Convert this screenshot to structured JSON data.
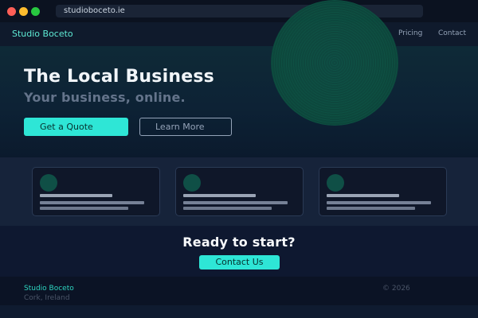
{
  "browser": {
    "url": "studioboceto.ie"
  },
  "nav": {
    "brand": "Studio Boceto",
    "links": [
      "",
      "",
      "",
      "Pricing",
      "Contact"
    ]
  },
  "hero": {
    "title": "The Local Business",
    "subtitle": "Your business, online.",
    "primary_button": "Get a Quote",
    "secondary_button": "Learn More"
  },
  "cta": {
    "title": "Ready to start?",
    "button": "Contact Us"
  },
  "footer": {
    "brand": "Studio Boceto",
    "location": "Cork, Ireland",
    "copyright": "© 2026"
  },
  "colors": {
    "accent": "#2ee6d6",
    "brand_text": "#5eead4",
    "page_background": "#0b1220",
    "card_background": "#0f1729",
    "muted_text": "#94a3b8",
    "globe": "#0d4a3e"
  },
  "icons": {
    "window_controls": [
      "close-window-dot",
      "minimize-window-dot",
      "maximize-window-dot"
    ],
    "decorative": "globe-graphic"
  }
}
